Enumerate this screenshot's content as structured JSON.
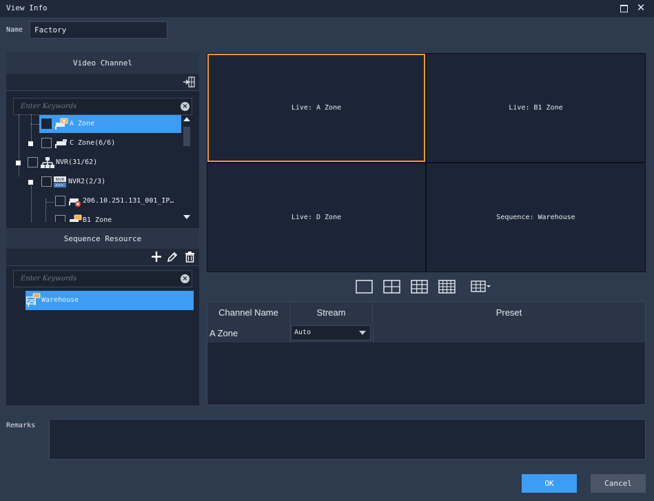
{
  "window": {
    "title": "View Info"
  },
  "name_field": {
    "label": "Name",
    "value": "Factory"
  },
  "video_channel": {
    "header": "Video Channel",
    "search_placeholder": "Enter Keywords",
    "tree": [
      {
        "label": "A Zone",
        "selected": true,
        "icon": "camera-icon"
      },
      {
        "label": "C Zone(6/6)",
        "selected": false,
        "icon": "camera-icon"
      },
      {
        "label": "NVR(31/62)",
        "selected": false,
        "icon": "network-icon"
      },
      {
        "label": "NVR2(2/3)",
        "selected": false,
        "icon": "nvr-icon"
      },
      {
        "label": "206.10.251.131_001_IP…",
        "selected": false,
        "icon": "camera-offline-icon"
      },
      {
        "label": "B1 Zone",
        "selected": false,
        "icon": "camera-icon"
      }
    ]
  },
  "sequence_resource": {
    "header": "Sequence Resource",
    "search_placeholder": "Enter Keywords",
    "items": [
      {
        "label": "Warehouse",
        "icon": "sequence-icon"
      }
    ]
  },
  "preview": {
    "cells": [
      {
        "label": "Live: A Zone",
        "active": true
      },
      {
        "label": "Live: B1 Zone",
        "active": false
      },
      {
        "label": "Live: D Zone",
        "active": false
      },
      {
        "label": "Sequence: Warehouse",
        "active": false
      }
    ]
  },
  "table": {
    "columns": [
      "Channel Name",
      "Stream",
      "Preset"
    ],
    "rows": [
      {
        "channel_name": "A Zone",
        "stream": "Auto",
        "preset": ""
      }
    ]
  },
  "remarks": {
    "label": "Remarks",
    "value": ""
  },
  "buttons": {
    "ok": "OK",
    "cancel": "Cancel"
  },
  "colors": {
    "accent": "#3d9df4",
    "active_border": "#f5972b",
    "background": "#2e3a4d",
    "panel": "#1c2535"
  }
}
